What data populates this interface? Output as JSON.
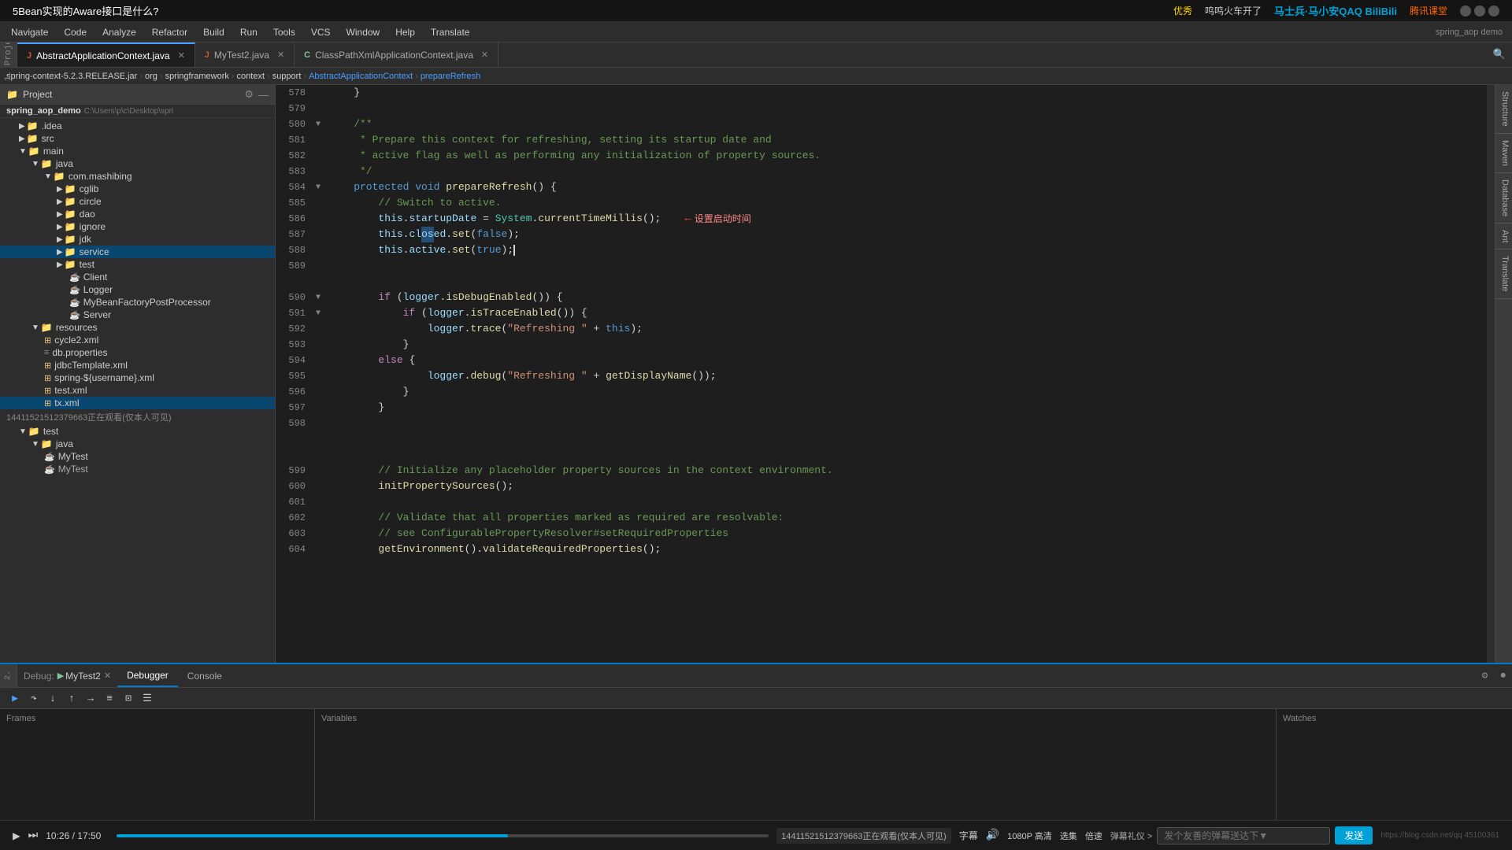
{
  "top_bar": {
    "question": "5Bean实现的Aware接口是什么?",
    "platform": "优秀",
    "creator": "鸣鸣火车开了",
    "bilibili_label": "马士兵·马小安QAQ BiliBili",
    "course_label": "腾讯课堂"
  },
  "menu": {
    "items": [
      "Navigate",
      "Code",
      "Analyze",
      "Refactor",
      "Build",
      "Run",
      "Tools",
      "VCS",
      "Window",
      "Help",
      "Translate"
    ]
  },
  "breadcrumb": {
    "parts": [
      "spring-context-5.2.3.RELEASE.jar",
      "org",
      "springframework",
      "context",
      "support",
      "AbstractApplicationContext",
      "prepareRefresh"
    ]
  },
  "tabs": [
    {
      "label": "AbstractApplicationContext.java",
      "type": "java",
      "active": true
    },
    {
      "label": "MyTest2.java",
      "type": "java",
      "active": false
    },
    {
      "label": "ClassPathXmlApplicationContext.java",
      "type": "java",
      "active": false
    }
  ],
  "project_name": "spring_aop_demo",
  "project_path": "C:\\Users\\p\\c\\Desktop\\spri",
  "sidebar": {
    "header": "Project",
    "tree": [
      {
        "label": ".idea",
        "type": "folder",
        "indent": 0,
        "expanded": false
      },
      {
        "label": "src",
        "type": "folder",
        "indent": 0,
        "expanded": false
      },
      {
        "label": "main",
        "type": "folder",
        "indent": 1,
        "expanded": true
      },
      {
        "label": "java",
        "type": "folder",
        "indent": 2,
        "expanded": true
      },
      {
        "label": "com.mashibing",
        "type": "folder",
        "indent": 3,
        "expanded": true
      },
      {
        "label": "cglib",
        "type": "folder",
        "indent": 4,
        "expanded": false
      },
      {
        "label": "circle",
        "type": "folder",
        "indent": 4,
        "expanded": false
      },
      {
        "label": "dao",
        "type": "folder",
        "indent": 4,
        "expanded": false
      },
      {
        "label": "ignore",
        "type": "folder",
        "indent": 4,
        "expanded": false
      },
      {
        "label": "jdk",
        "type": "folder",
        "indent": 4,
        "expanded": false
      },
      {
        "label": "service",
        "type": "folder",
        "indent": 4,
        "expanded": false,
        "selected": true
      },
      {
        "label": "test",
        "type": "folder",
        "indent": 4,
        "expanded": false
      },
      {
        "label": "Client",
        "type": "java",
        "indent": 5
      },
      {
        "label": "Logger",
        "type": "java",
        "indent": 5
      },
      {
        "label": "MyBeanFactoryPostProcessor",
        "type": "java",
        "indent": 5
      },
      {
        "label": "Server",
        "type": "java",
        "indent": 5
      },
      {
        "label": "resources",
        "type": "folder",
        "indent": 2,
        "expanded": true
      },
      {
        "label": "cycle2.xml",
        "type": "xml",
        "indent": 3
      },
      {
        "label": "db.properties",
        "type": "props",
        "indent": 3
      },
      {
        "label": "jdbcTemplate.xml",
        "type": "xml",
        "indent": 3
      },
      {
        "label": "spring-${username}.xml",
        "type": "xml",
        "indent": 3
      },
      {
        "label": "test.xml",
        "type": "xml",
        "indent": 3
      },
      {
        "label": "tx.xml",
        "type": "xml",
        "indent": 3,
        "selected": true
      },
      {
        "label": "test",
        "type": "folder",
        "indent": 1,
        "expanded": true
      },
      {
        "label": "java",
        "type": "folder",
        "indent": 2,
        "expanded": true
      },
      {
        "label": "MyTest",
        "type": "java",
        "indent": 3
      },
      {
        "label": "MyTest2",
        "type": "java",
        "indent": 3
      }
    ]
  },
  "code": {
    "lines": [
      {
        "num": "578",
        "content": "    }",
        "gutter": ""
      },
      {
        "num": "579",
        "content": "",
        "gutter": ""
      },
      {
        "num": "580",
        "content": "    /**",
        "gutter": "fold"
      },
      {
        "num": "581",
        "content": "     * Prepare this context for refreshing, setting its startup date and",
        "gutter": ""
      },
      {
        "num": "582",
        "content": "     * active flag as well as performing any initialization of property sources.",
        "gutter": ""
      },
      {
        "num": "583",
        "content": "     */",
        "gutter": ""
      },
      {
        "num": "584",
        "content": "    protected void prepareRefresh() {",
        "gutter": "fold"
      },
      {
        "num": "585",
        "content": "        // Switch to active.",
        "gutter": ""
      },
      {
        "num": "586",
        "content": "        this.startupDate = System.currentTimeMillis();",
        "gutter": "",
        "arrow": "设置启动时间"
      },
      {
        "num": "587",
        "content": "        this.closed.set(false);",
        "gutter": ""
      },
      {
        "num": "588",
        "content": "        this.active.set(true);",
        "gutter": ""
      },
      {
        "num": "589",
        "content": "",
        "gutter": ""
      },
      {
        "num": "590",
        "content": "        if (logger.isDebugEnabled()) {",
        "gutter": "fold"
      },
      {
        "num": "591",
        "content": "            if (logger.isTraceEnabled()) {",
        "gutter": "fold"
      },
      {
        "num": "592",
        "content": "                logger.trace(\"Refreshing \" + this);",
        "gutter": ""
      },
      {
        "num": "593",
        "content": "            }",
        "gutter": ""
      },
      {
        "num": "594",
        "content": "        else {",
        "gutter": ""
      },
      {
        "num": "595",
        "content": "                logger.debug(\"Refreshing \" + getDisplayName());",
        "gutter": ""
      },
      {
        "num": "596",
        "content": "            }",
        "gutter": ""
      },
      {
        "num": "597",
        "content": "        }",
        "gutter": ""
      },
      {
        "num": "598",
        "content": "",
        "gutter": ""
      },
      {
        "num": "599",
        "content": "        // Initialize any placeholder property sources in the context environment.",
        "gutter": ""
      },
      {
        "num": "600",
        "content": "        initPropertySources();",
        "gutter": ""
      },
      {
        "num": "601",
        "content": "",
        "gutter": ""
      },
      {
        "num": "602",
        "content": "        // Validate that all properties marked as required are resolvable:",
        "gutter": ""
      },
      {
        "num": "603",
        "content": "        // see ConfigurablePropertyResolver#setRequiredProperties",
        "gutter": ""
      },
      {
        "num": "604",
        "content": "        getEnvironment().validateRequiredProperties();",
        "gutter": ""
      }
    ]
  },
  "debug": {
    "label": "Debug:",
    "session": "MyTest2",
    "tabs": [
      "Debugger",
      "Console"
    ],
    "frames_header": "Frames",
    "variables_header": "Variables",
    "watches_header": "Watches"
  },
  "viewer_notice": "14411521512379663正在观看(仅本人可见)",
  "status_bar": {
    "play_pause": "▶",
    "time": "10:26 / 17:50",
    "resolution": "1080P 高清",
    "select": "选集",
    "speed": "倍速",
    "danmaku_placeholder": "发个友善的弹幕送达下▼",
    "danmaku_btn": "弹幕礼仪 >",
    "send_label": "发送",
    "subtitle_label": "https://blog.csdn.net/qq 45100361",
    "volume_icon": "🔊"
  },
  "right_tabs": [
    "Structure",
    "Maven",
    "Database",
    "Ant",
    "Translate"
  ],
  "bottom_bar_notice": "14411521512379663正在观看(仅本人可见)"
}
